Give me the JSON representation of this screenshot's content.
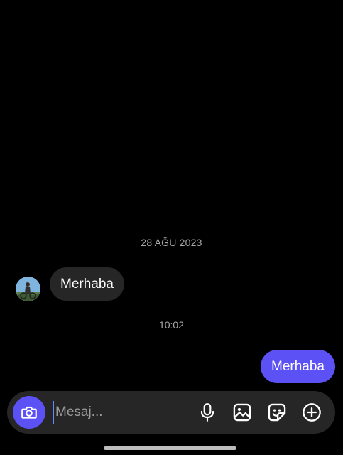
{
  "conversation": {
    "date_divider": "28 AĞU 2023",
    "time_divider": "10:02",
    "messages": [
      {
        "direction": "incoming",
        "text": "Merhaba"
      },
      {
        "direction": "outgoing",
        "text": "Merhaba"
      }
    ]
  },
  "composer": {
    "placeholder": "Mesaj...",
    "value": ""
  },
  "icons": {
    "camera": "camera-icon",
    "microphone": "microphone-icon",
    "gallery": "gallery-icon",
    "sticker": "sticker-icon",
    "add": "plus-circle-icon"
  },
  "colors": {
    "background": "#000000",
    "incoming_bubble": "#262626",
    "outgoing_bubble": "#5b51f4",
    "composer": "#262626",
    "muted_text": "#a8a8a8"
  }
}
